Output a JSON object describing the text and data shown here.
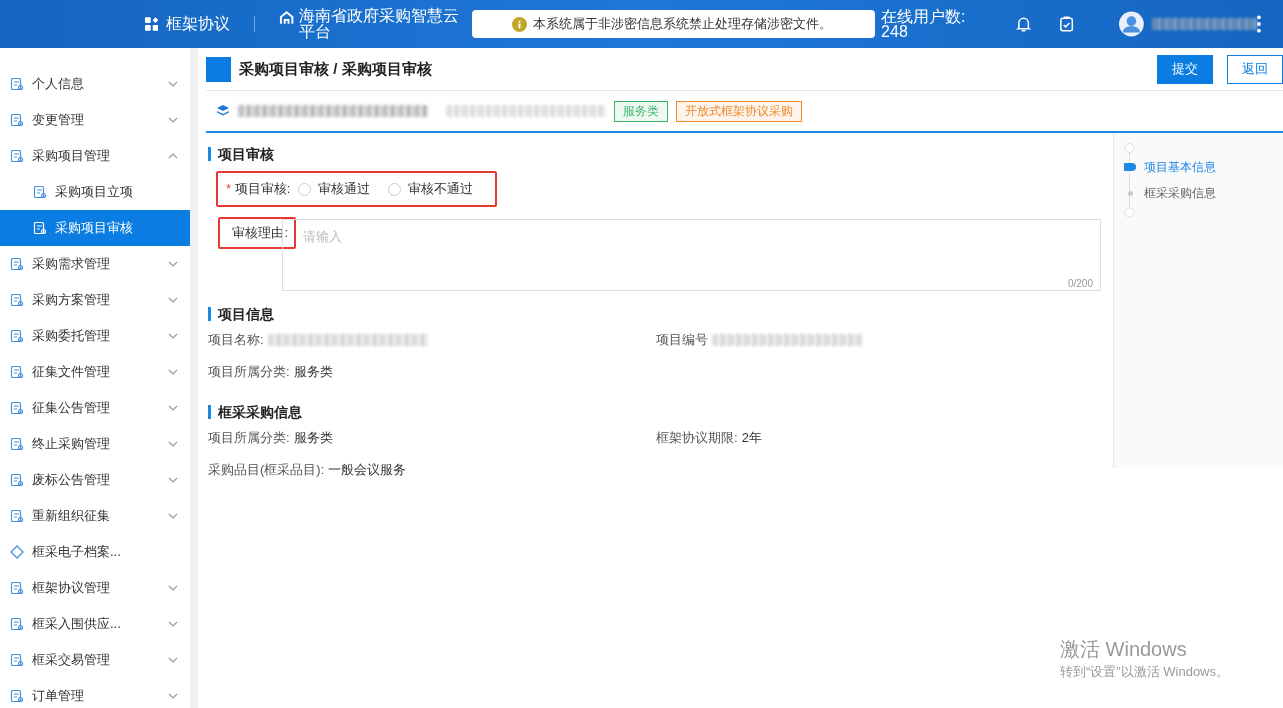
{
  "header": {
    "module": "框架协议",
    "platform": "海南省政府采购智慧云平台",
    "notice": "本系统属于非涉密信息系统禁止处理存储涉密文件。",
    "online_label": "在线用户数:",
    "online_count": "248"
  },
  "sidebar": {
    "items": [
      {
        "label": "个人信息",
        "expanded": false,
        "selected": false
      },
      {
        "label": "变更管理",
        "expanded": false,
        "selected": false
      },
      {
        "label": "采购项目管理",
        "expanded": true,
        "selected": false,
        "children": [
          {
            "label": "采购项目立项",
            "selected": false
          },
          {
            "label": "采购项目审核",
            "selected": true
          }
        ]
      },
      {
        "label": "采购需求管理",
        "expanded": false,
        "selected": false
      },
      {
        "label": "采购方案管理",
        "expanded": false,
        "selected": false
      },
      {
        "label": "采购委托管理",
        "expanded": false,
        "selected": false
      },
      {
        "label": "征集文件管理",
        "expanded": false,
        "selected": false
      },
      {
        "label": "征集公告管理",
        "expanded": false,
        "selected": false
      },
      {
        "label": "终止采购管理",
        "expanded": false,
        "selected": false
      },
      {
        "label": "废标公告管理",
        "expanded": false,
        "selected": false
      },
      {
        "label": "重新组织征集",
        "expanded": false,
        "selected": false
      },
      {
        "label": "框采电子档案...",
        "selected": false,
        "kind": "link"
      },
      {
        "label": "框架协议管理",
        "expanded": false,
        "selected": false
      },
      {
        "label": "框采入围供应...",
        "expanded": false,
        "selected": false
      },
      {
        "label": "框采交易管理",
        "expanded": false,
        "selected": false
      },
      {
        "label": "订单管理",
        "expanded": false,
        "selected": false
      }
    ]
  },
  "page": {
    "breadcrumb": "采购项目审核 / 采购项目审核",
    "buttons": [
      {
        "label": "提交",
        "kind": "primary"
      },
      {
        "label": "返回",
        "kind": "plain"
      }
    ],
    "tags": [
      {
        "label": "服务类",
        "color": "#3bb36b"
      },
      {
        "label": "开放式框架协议采购",
        "color": "#f08a2c"
      }
    ]
  },
  "review": {
    "title": "项目审核",
    "required_mark": "*",
    "field_label": "项目审核:",
    "options": [
      {
        "label": "审核通过",
        "selected": false
      },
      {
        "label": "审核不通过",
        "selected": false
      }
    ],
    "reason_label": "审核理由:",
    "placeholder": "请输入",
    "counter": "0/200"
  },
  "info": {
    "title": "项目信息",
    "fields": [
      {
        "label": "项目名称:"
      },
      {
        "label": "项目编号"
      },
      {
        "label": "项目所属分类:",
        "value": "服务类"
      }
    ]
  },
  "framework": {
    "title": "框采采购信息",
    "fields": [
      {
        "label": "项目所属分类:",
        "value": "服务类"
      },
      {
        "label": "框架协议期限:",
        "value": "2年"
      },
      {
        "label": "采购品目(框采品目):",
        "value": "一般会议服务"
      }
    ]
  },
  "anchor_nav": [
    {
      "label": "项目基本信息",
      "selected": true
    },
    {
      "label": "框采采购信息",
      "selected": false
    }
  ],
  "os_watermark": {
    "title": "激活 Windows",
    "subtitle": "转到“设置”以激活 Windows。"
  }
}
